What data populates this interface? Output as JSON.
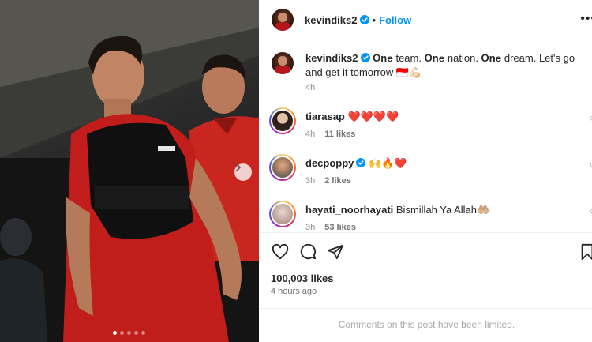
{
  "post_image": {
    "description_icon": "photo-of-players",
    "carousel": {
      "total": 5,
      "active": 1
    },
    "next_icon": "chevron-right-icon"
  },
  "header": {
    "username": "kevindiks2",
    "verified": true,
    "separator": "•",
    "follow_label": "Follow",
    "more_icon": "more-horizontal-icon"
  },
  "caption": {
    "username": "kevindiks2",
    "text": "𝐎𝐧𝐞 team. 𝐎𝐧𝐞 nation. 𝐎𝐧𝐞 dream. Let's go and get it tomorrow 🇮🇩💪🏻",
    "time": "4h"
  },
  "comments": [
    {
      "username": "tiarasap",
      "text": "❤️❤️❤️❤️",
      "time": "4h",
      "likes": "11 likes",
      "verified": false
    },
    {
      "username": "decpoppy",
      "text": "🙌🔥❤️",
      "time": "3h",
      "likes": "2 likes",
      "verified": true
    },
    {
      "username": "hayati_noorhayati",
      "text": "Bismillah Ya Allah🤲🏼",
      "time": "3h",
      "likes": "53 likes",
      "verified": false
    }
  ],
  "actions": {
    "like_icon": "heart-icon",
    "comment_icon": "comment-icon",
    "share_icon": "send-icon",
    "save_icon": "bookmark-icon"
  },
  "stats": {
    "likes": "100,003 likes",
    "posted": "4 hours ago"
  },
  "comments_notice": "Comments on this post have been limited.",
  "colors": {
    "link_blue": "#0095f6",
    "verified_blue": "#0095f6",
    "muted_text": "#8e8e8e",
    "jersey_red": "#b5161b"
  }
}
